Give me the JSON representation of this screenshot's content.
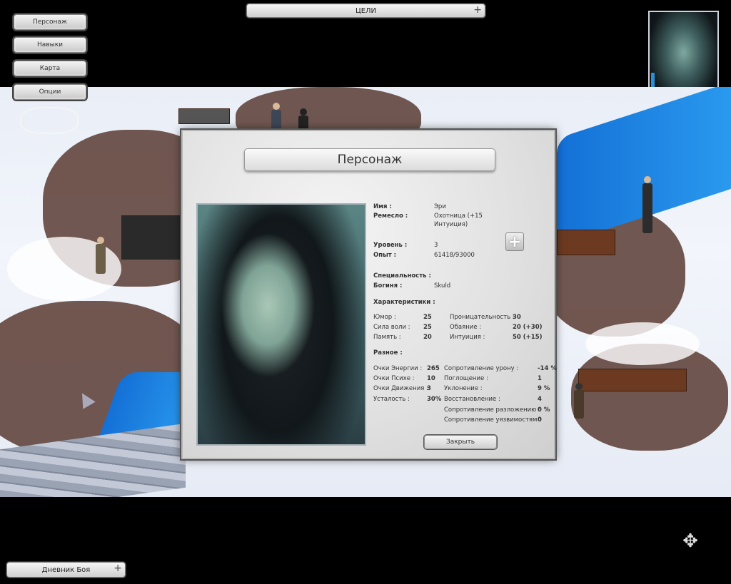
{
  "top_bar": {
    "goals_label": "ЦЕЛИ",
    "plus_symbol": "+"
  },
  "left_menu": {
    "items": [
      {
        "label": "Персонаж"
      },
      {
        "label": "Навыки"
      },
      {
        "label": "Карта"
      },
      {
        "label": "Опции"
      }
    ]
  },
  "combat_log": {
    "label": "Дневник Боя",
    "plus_symbol": "+"
  },
  "dialog": {
    "title": "Персонаж",
    "plus_symbol": "+",
    "close_label": "Закрыть",
    "name_label": "Имя :",
    "name_value": "Эри",
    "craft_label": "Ремесло :",
    "craft_value_line1": "Охотница (+15",
    "craft_value_line2": "Интуиция)",
    "level_label": "Уровень :",
    "level_value": "3",
    "exp_label": "Опыт :",
    "exp_value": "61418/93000",
    "spec_label": "Специальность :",
    "spec_value": "",
    "goddess_label": "Богиня :",
    "goddess_value": "Skuld",
    "stats_header": "Характеристики :",
    "stats_left": [
      {
        "label": "Юмор :",
        "value": "25"
      },
      {
        "label": "Сила воли :",
        "value": "25"
      },
      {
        "label": "Память :",
        "value": "20"
      }
    ],
    "stats_right": [
      {
        "label": "Проницательность :",
        "value": "30"
      },
      {
        "label": "Обаяние :",
        "value": "20 (+30)"
      },
      {
        "label": "Интуиция :",
        "value": "50 (+15)"
      }
    ],
    "misc_header": "Разное :",
    "misc_left": [
      {
        "label": "Очки Энергии :",
        "value": "265"
      },
      {
        "label": "Очки Психе :",
        "value": "10"
      },
      {
        "label": "Очки Движения :",
        "value": "3"
      },
      {
        "label": "Усталость :",
        "value": "30%"
      }
    ],
    "misc_right": [
      {
        "label": "Сопротивление урону :",
        "value": "-14 %"
      },
      {
        "label": "Поглощение :",
        "value": "1"
      },
      {
        "label": "Уклонение :",
        "value": "9 %"
      },
      {
        "label": "Восстановление :",
        "value": "4"
      },
      {
        "label": "Сопротивление разложению :",
        "value": "0 %"
      },
      {
        "label": "Сопротивление уязвимостям :",
        "value": "0"
      }
    ]
  },
  "icons": {
    "compass": "four-arrows-move-icon",
    "cursor": "arrow-cursor-icon"
  },
  "colors": {
    "river": "#1e8ae6",
    "dirt": "#5b3b33",
    "snow": "#eef2f9",
    "frame": "#555555"
  }
}
